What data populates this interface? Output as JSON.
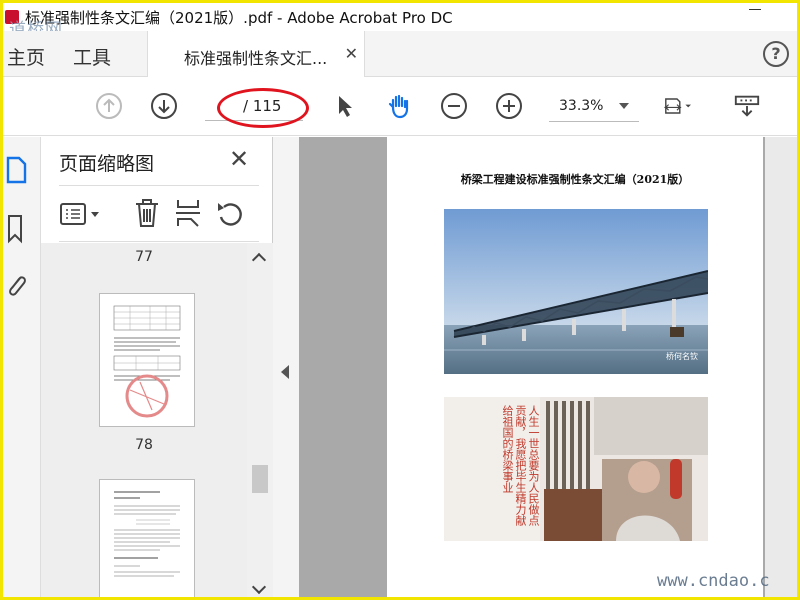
{
  "window": {
    "title": "标准强制性条文汇编（2021版）.pdf - Adobe Acrobat Pro DC",
    "watermark_top": "道桥网",
    "watermark_bottom": "www.cndao.c"
  },
  "tabs": {
    "home": "主页",
    "tools": "工具",
    "document": "标准强制性条文汇..."
  },
  "toolbar": {
    "page_total": "/ 115",
    "zoom": "33.3%"
  },
  "thumbnails": {
    "heading": "页面缩略图",
    "pages": [
      "77",
      "78"
    ]
  },
  "document": {
    "title": "桥梁工程建设标准强制性条文汇编（2021版）",
    "photo_caption": "桥何名钦",
    "calligraphy": "人生一世总要为人民做点贡献，我愿把毕生精力献给祖国的桥梁事业"
  },
  "colors": {
    "accent": "#1473e6",
    "highlight": "#e0141e",
    "frame": "#f2e600"
  }
}
